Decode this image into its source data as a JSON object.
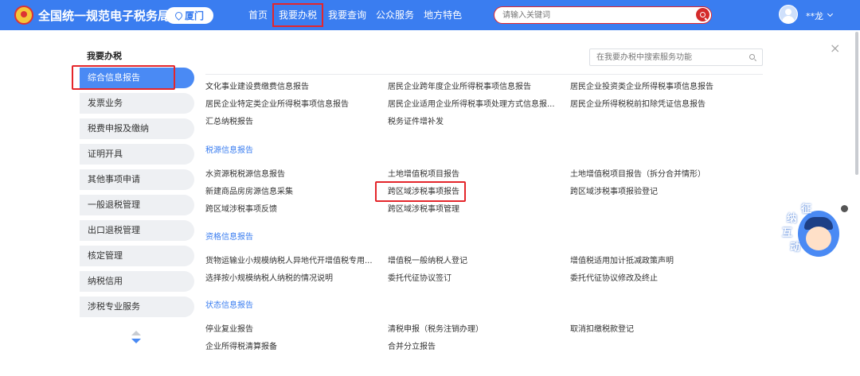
{
  "header": {
    "site_title": "全国统一规范电子税务局",
    "city": "厦门",
    "nav": [
      "首页",
      "我要办税",
      "我要查询",
      "公众服务",
      "地方特色"
    ],
    "search_placeholder": "请输入关键词",
    "user_name": "**龙"
  },
  "sidebar": {
    "title": "我要办税",
    "items": [
      "综合信息报告",
      "发票业务",
      "税费申报及缴纳",
      "证明开具",
      "其他事项申请",
      "一般退税管理",
      "出口退税管理",
      "核定管理",
      "纳税信用",
      "涉税专业服务"
    ]
  },
  "main": {
    "search_placeholder": "在我要办税中搜索服务功能",
    "close_symbol": "×",
    "top_links": [
      "文化事业建设费缴费信息报告",
      "居民企业跨年度企业所得税事项信息报告",
      "居民企业投资类企业所得税事项信息报告",
      "居民企业特定类企业所得税事项信息报告",
      "居民企业适用企业所得税事项处理方式信息报...",
      "居民企业所得税税前扣除凭证信息报告",
      "汇总纳税报告",
      "税务证件增补发"
    ],
    "sections": [
      {
        "title": "税源信息报告",
        "links": [
          "水资源税税源信息报告",
          "土地增值税项目报告",
          "土地增值税项目报告（拆分合并情形）",
          "新建商品房房源信息采集",
          "跨区域涉税事项报告",
          "跨区域涉税事项报验登记",
          "跨区域涉税事项反馈",
          "跨区域涉税事项管理"
        ]
      },
      {
        "title": "资格信息报告",
        "links": [
          "货物运输业小规模纳税人异地代开增值税专用...",
          "增值税一般纳税人登记",
          "增值税适用加计抵减政策声明",
          "选择按小规模纳税人纳税的情况说明",
          "委托代征协议签订",
          "委托代征协议修改及终止"
        ]
      },
      {
        "title": "状态信息报告",
        "links": [
          "停业复业报告",
          "清税申报（税务注销办理）",
          "取消扣缴税款登记",
          "企业所得税清算报备",
          "合并分立报告"
        ]
      }
    ]
  },
  "mascot": {
    "chars": [
      "征",
      "纳",
      "互",
      "动"
    ]
  },
  "colors": {
    "header_blue": "#3a7df0",
    "highlight_red": "#e4262b",
    "link_blue": "#3a7df0",
    "active_side": "#4a8af4"
  },
  "icons": [
    "emblem-icon",
    "location-pin-icon",
    "search-icon",
    "avatar-icon",
    "chevron-down-icon",
    "close-icon",
    "scroll-up-icon",
    "scroll-down-icon"
  ]
}
